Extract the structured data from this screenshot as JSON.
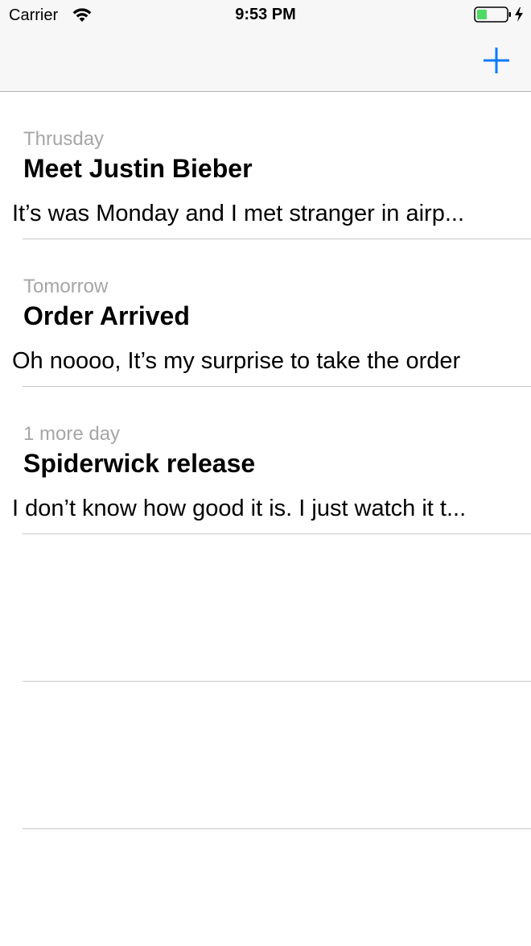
{
  "status_bar": {
    "carrier": "Carrier",
    "time": "9:53 PM",
    "battery_level": 0.35,
    "battery_charging": true
  },
  "nav_bar": {
    "add_icon": "plus-icon",
    "accent_color": "#0a7aff"
  },
  "events": [
    {
      "date": "Thrusday",
      "title": "Meet Justin Bieber",
      "body": "It’s was Monday and I met stranger in airp..."
    },
    {
      "date": "Tomorrow",
      "title": "Order Arrived",
      "body": "Oh noooo, It’s my surprise to take the order"
    },
    {
      "date": "1 more day",
      "title": "Spiderwick release",
      "body": "I don’t know how good it is. I just watch it t..."
    }
  ]
}
